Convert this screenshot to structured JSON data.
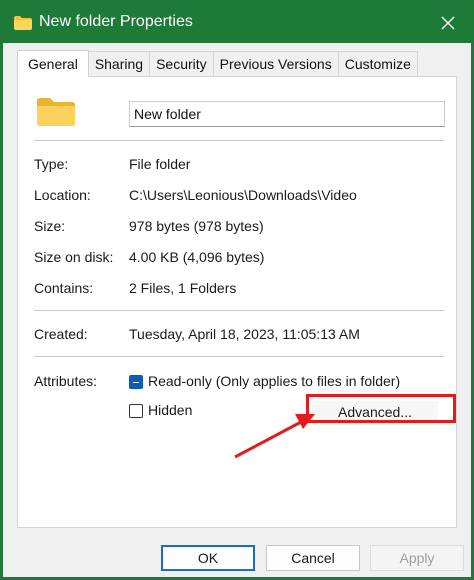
{
  "window": {
    "title": "New folder Properties"
  },
  "tabs": [
    {
      "label": "General",
      "active": true
    },
    {
      "label": "Sharing"
    },
    {
      "label": "Security"
    },
    {
      "label": "Previous Versions"
    },
    {
      "label": "Customize"
    }
  ],
  "general": {
    "folder_name": "New folder",
    "info": [
      {
        "label": "Type:",
        "value": "File folder"
      },
      {
        "label": "Location:",
        "value": "C:\\Users\\Leonious\\Downloads\\Video"
      },
      {
        "label": "Size:",
        "value": "978 bytes (978 bytes)"
      },
      {
        "label": "Size on disk:",
        "value": "4.00 KB (4,096 bytes)"
      },
      {
        "label": "Contains:",
        "value": "2 Files, 1 Folders"
      }
    ],
    "created": {
      "label": "Created:",
      "value": "Tuesday, April 18, 2023, 11:05:13 AM"
    },
    "attributes": {
      "label": "Attributes:",
      "readonly_label": "Read-only (Only applies to files in folder)",
      "readonly_state": "indeterminate",
      "hidden_label": "Hidden",
      "hidden_state": "unchecked",
      "advanced_label": "Advanced..."
    }
  },
  "footer": {
    "ok": "OK",
    "cancel": "Cancel",
    "apply": "Apply"
  },
  "colors": {
    "titlebar": "#1e7a37",
    "highlight": "#e21b1b",
    "checkbox_accent": "#0a5fb4",
    "folder": "#f5c342"
  },
  "icons": {
    "title": "folder-icon",
    "close": "close-icon",
    "folder": "folder-icon",
    "annotation": "arrow-annotation"
  }
}
